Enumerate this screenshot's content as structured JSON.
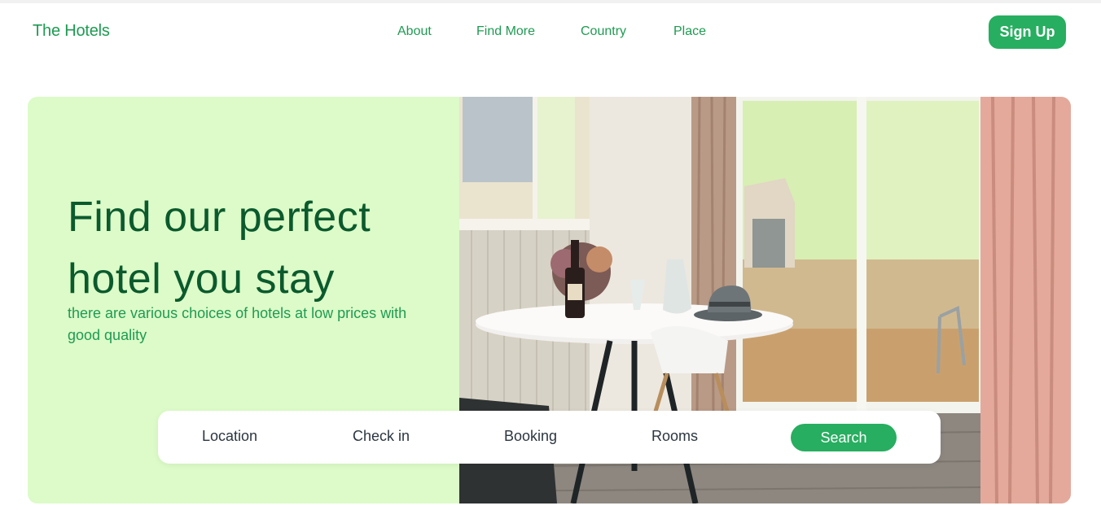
{
  "header": {
    "brand": "The Hotels",
    "nav": [
      "About",
      "Find More",
      "Country",
      "Place"
    ],
    "signup_label": "Sign Up"
  },
  "hero": {
    "headline": "Find our perfect hotel you stay",
    "subtext": "there are various choices of hotels at low prices with good quality"
  },
  "search": {
    "fields": [
      "Location",
      "Check in",
      "Booking",
      "Rooms"
    ],
    "button_label": "Search"
  },
  "colors": {
    "accent": "#27ae60",
    "brand_text": "#1e9b52",
    "headline": "#0b5a2d",
    "hero_bg": "#dcfbc8"
  }
}
